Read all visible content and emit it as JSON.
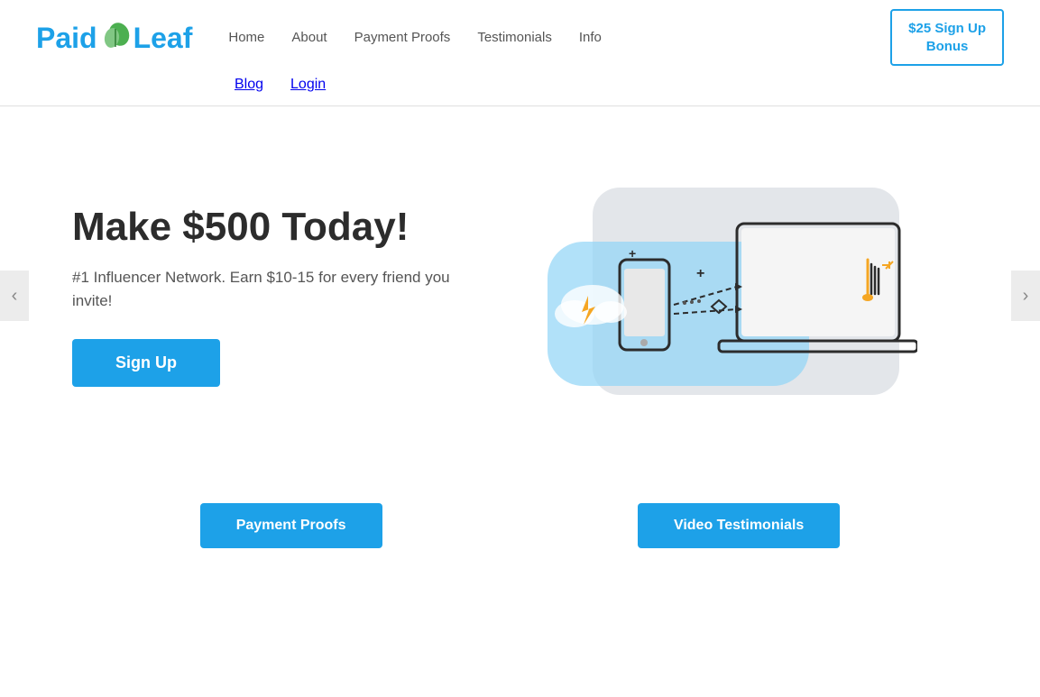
{
  "header": {
    "logo_text_paid": "Paid",
    "logo_text_leaf": "Leaf",
    "nav": [
      {
        "label": "Home",
        "href": "#"
      },
      {
        "label": "About",
        "href": "#"
      },
      {
        "label": "Payment Proofs",
        "href": "#"
      },
      {
        "label": "Testimonials",
        "href": "#"
      },
      {
        "label": "Info",
        "href": "#"
      }
    ],
    "sub_nav": [
      {
        "label": "Blog",
        "href": "#"
      },
      {
        "label": "Login",
        "href": "#"
      }
    ],
    "signup_btn": "$25 Sign Up\nBonus"
  },
  "hero": {
    "title": "Make $500 Today!",
    "subtitle": "#1 Influencer Network. Earn $10-15 for every friend you invite!",
    "cta_label": "Sign Up"
  },
  "carousel": {
    "left_arrow": "‹",
    "right_arrow": "›"
  },
  "bottom_buttons": [
    {
      "label": "Payment Proofs"
    },
    {
      "label": "Video Testimonials"
    }
  ]
}
